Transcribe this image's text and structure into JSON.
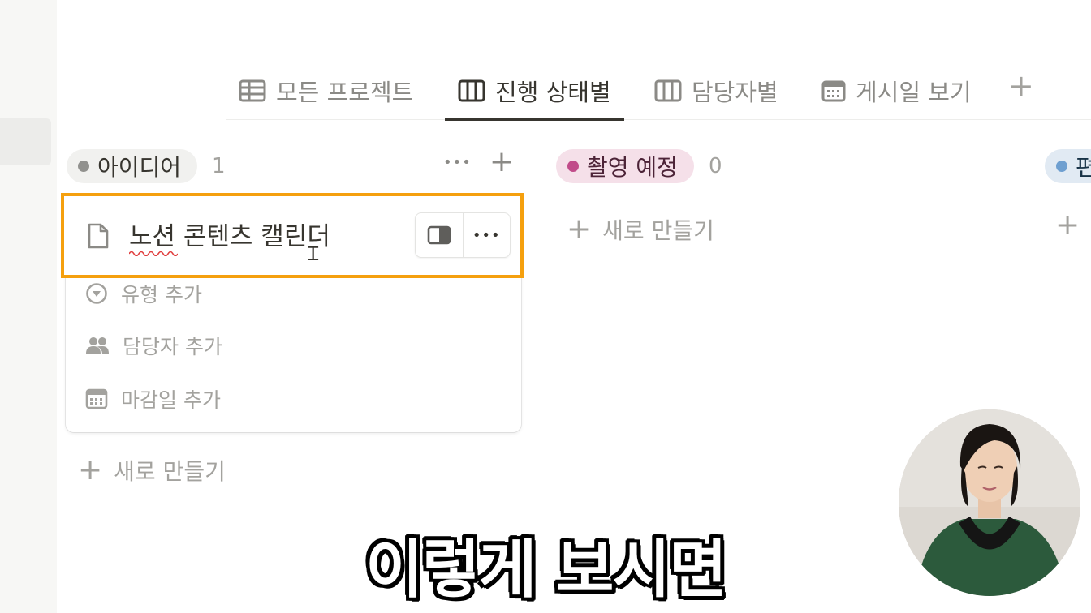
{
  "tabs": [
    {
      "label": "모든 프로젝트",
      "icon": "table-icon"
    },
    {
      "label": "진행 상태별",
      "icon": "board-icon",
      "active": true
    },
    {
      "label": "담당자별",
      "icon": "board-icon"
    },
    {
      "label": "게시일 보기",
      "icon": "calendar-icon"
    }
  ],
  "tab_add": "+",
  "columns": [
    {
      "label": "아이디어",
      "count": "1",
      "dot_color": "#91918e",
      "pill_color": "#f1f1ef",
      "text_color": "#37352f"
    },
    {
      "label": "촬영 예정",
      "count": "0",
      "dot_color": "#c14c8a",
      "pill_color": "#f5e0e9",
      "text_color": "#4c2337"
    },
    {
      "label": "편",
      "dot_color": "#6e9fd0",
      "pill_color": "#e1eaf3"
    }
  ],
  "column_actions": {
    "more": "•••",
    "add": "+"
  },
  "card": {
    "title": "노션 콘텐츠 캘린더",
    "properties": [
      {
        "label": "유형 추가",
        "icon": "select-icon"
      },
      {
        "label": "담당자 추가",
        "icon": "people-icon"
      },
      {
        "label": "마감일 추가",
        "icon": "calendar-icon"
      }
    ],
    "more": "•••"
  },
  "new_item": {
    "plus": "+",
    "label": "새로 만들기"
  },
  "subtitle": "이렇게 보시면",
  "colors": {
    "highlight": "#f5a00e",
    "text": "#37352f",
    "muted": "#a3a29e"
  }
}
